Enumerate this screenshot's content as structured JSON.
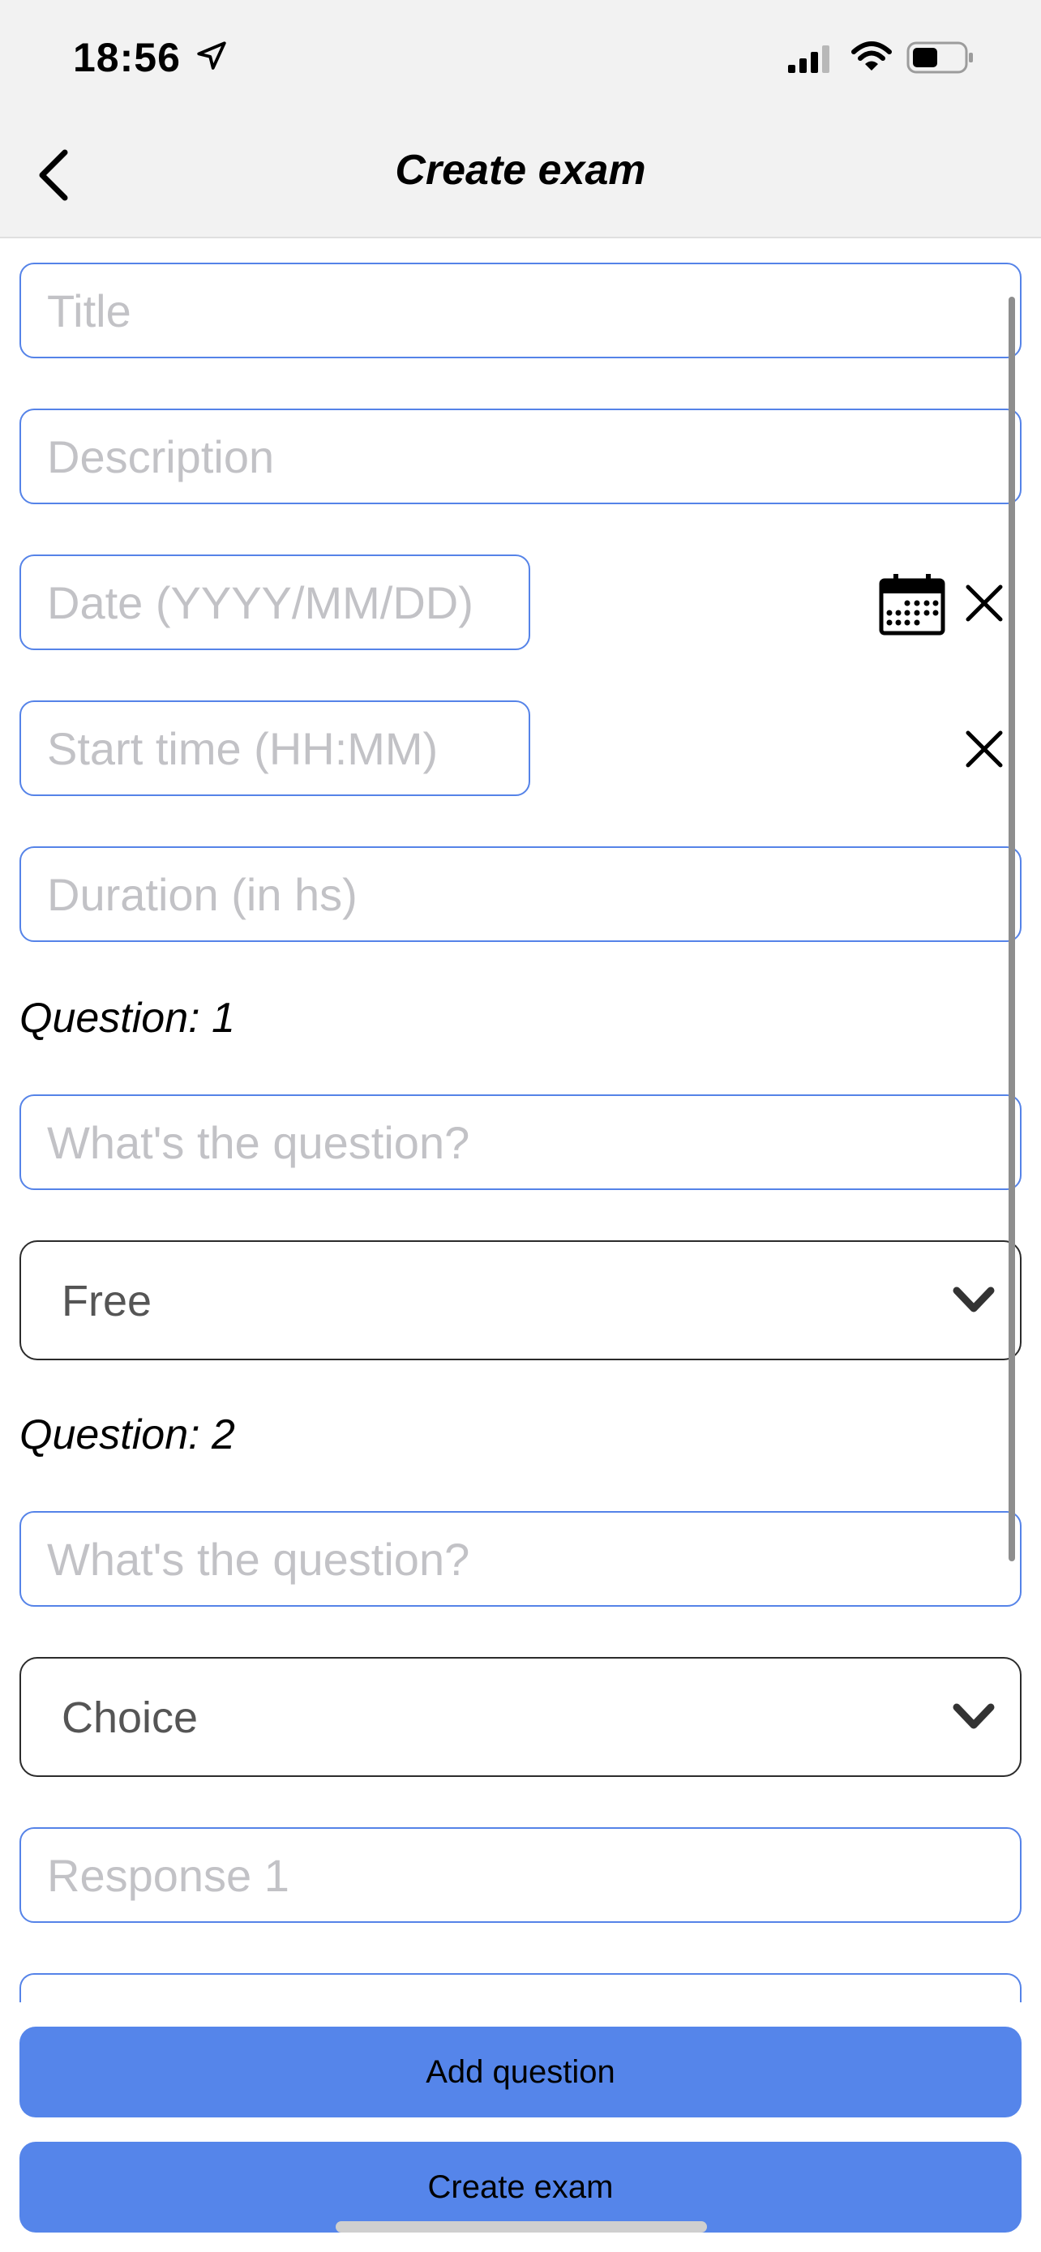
{
  "status_bar": {
    "time": "18:56"
  },
  "header": {
    "title": "Create exam"
  },
  "form": {
    "title_placeholder": "Title",
    "description_placeholder": "Description",
    "date_placeholder": "Date (YYYY/MM/DD)",
    "start_time_placeholder": "Start time (HH:MM)",
    "duration_placeholder": "Duration (in hs)"
  },
  "questions": [
    {
      "label": "Question: 1",
      "question_placeholder": "What's the question?",
      "type": "Free"
    },
    {
      "label": "Question: 2",
      "question_placeholder": "What's the question?",
      "type": "Choice",
      "responses": [
        {
          "placeholder": "Response 1"
        }
      ]
    }
  ],
  "buttons": {
    "add_question": "Add question",
    "create_exam": "Create exam"
  },
  "icons": {
    "back": "chevron-left-icon",
    "calendar": "calendar-icon",
    "clear": "close-icon",
    "dropdown": "chevron-down-icon",
    "location": "location-arrow-icon",
    "signal": "signal-icon",
    "wifi": "wifi-icon",
    "battery": "battery-icon"
  },
  "colors": {
    "accent": "#5583e8",
    "button": "#5585ea",
    "header_bg": "#f2f2f2"
  }
}
